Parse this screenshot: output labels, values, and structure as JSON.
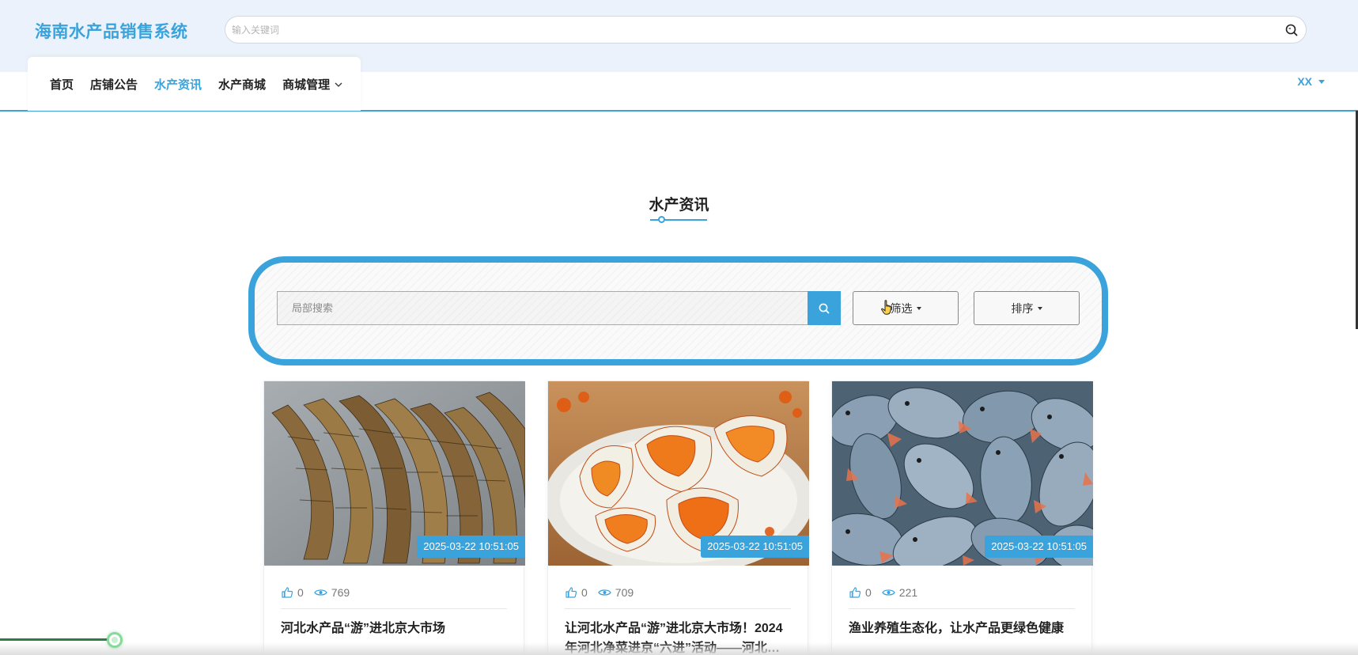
{
  "header": {
    "brand": "海南水产品销售系统",
    "search_placeholder": "输入关键词"
  },
  "nav": {
    "items": [
      {
        "label": "首页"
      },
      {
        "label": "店铺公告"
      },
      {
        "label": "水产资讯",
        "active": true
      },
      {
        "label": "水产商城"
      },
      {
        "label": "商城管理",
        "has_dropdown": true
      }
    ],
    "user": "XX"
  },
  "section": {
    "title": "水产资讯"
  },
  "filter": {
    "search_placeholder": "局部搜索",
    "filter_label": "筛选",
    "sort_label": "排序"
  },
  "articles": [
    {
      "date": "2025-03-22 10:51:05",
      "likes": "0",
      "views": "769",
      "title": "河北水产品“游”进北京大市场",
      "image": "shrimp-photo"
    },
    {
      "date": "2025-03-22 10:51:05",
      "likes": "0",
      "views": "709",
      "title": "让河北水产品“游”进北京大市场！2024年河北净菜进京“六进”活动——河北…",
      "image": "crab-plate-photo"
    },
    {
      "date": "2025-03-22 10:51:05",
      "likes": "0",
      "views": "221",
      "title": "渔业养殖生态化，让水产品更绿色健康",
      "image": "pomfret-fish-photo"
    }
  ],
  "colors": {
    "accent": "#3aa3dc",
    "header_bg": "#ebf2fb",
    "progress": "#2e7d46"
  }
}
